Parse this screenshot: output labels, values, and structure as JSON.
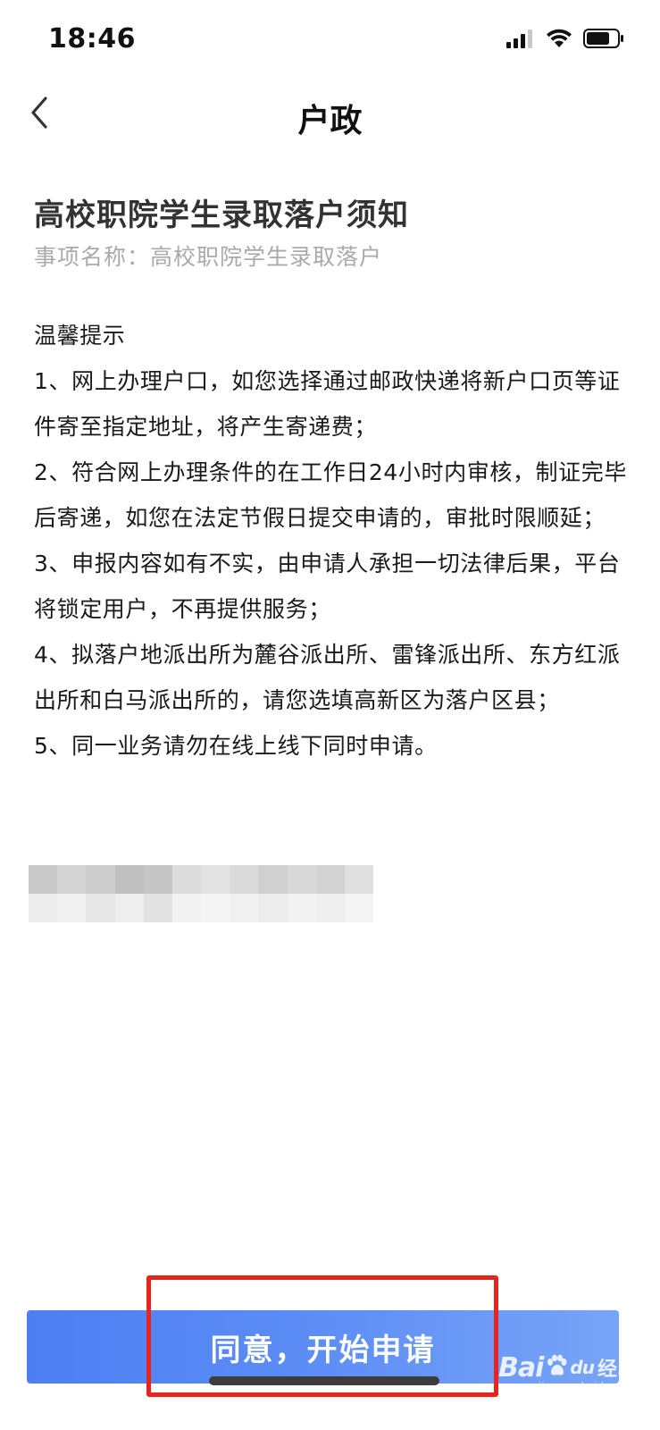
{
  "status_bar": {
    "time": "18:46"
  },
  "nav": {
    "title": "户政"
  },
  "document": {
    "title": "高校职院学生录取落户须知",
    "subtitle": "事项名称：高校职院学生录取落户"
  },
  "tips": {
    "heading": "温馨提示",
    "items": [
      "1、网上办理户口，如您选择通过邮政快递将新户口页等证件寄至指定地址，将产生寄递费；",
      "2、符合网上办理条件的在工作日24小时内审核，制证完毕后寄递，如您在法定节假日提交申请的，审批时限顺延；",
      "3、申报内容如有不实，由申请人承担一切法律后果，平台将锁定用户，不再提供服务；",
      "4、拟落户地派出所为麓谷派出所、雷锋派出所、东方红派出所和白马派出所的，请您选填高新区为落户区县；",
      "5、同一业务请勿在线上线下同时申请。"
    ]
  },
  "actions": {
    "agree_label": "同意，开始申请"
  },
  "watermark": {
    "brand": "Bai",
    "brand_suffix": "du",
    "cn": "经验",
    "url": "jingyan.baidu.com"
  },
  "colors": {
    "accent": "#4d7ff3",
    "highlight": "#e8241f",
    "subtitle": "#aaaaaa"
  },
  "icons": {
    "back": "chevron-left-icon",
    "signal": "cellular-signal-icon",
    "wifi": "wifi-icon",
    "battery": "battery-icon"
  }
}
